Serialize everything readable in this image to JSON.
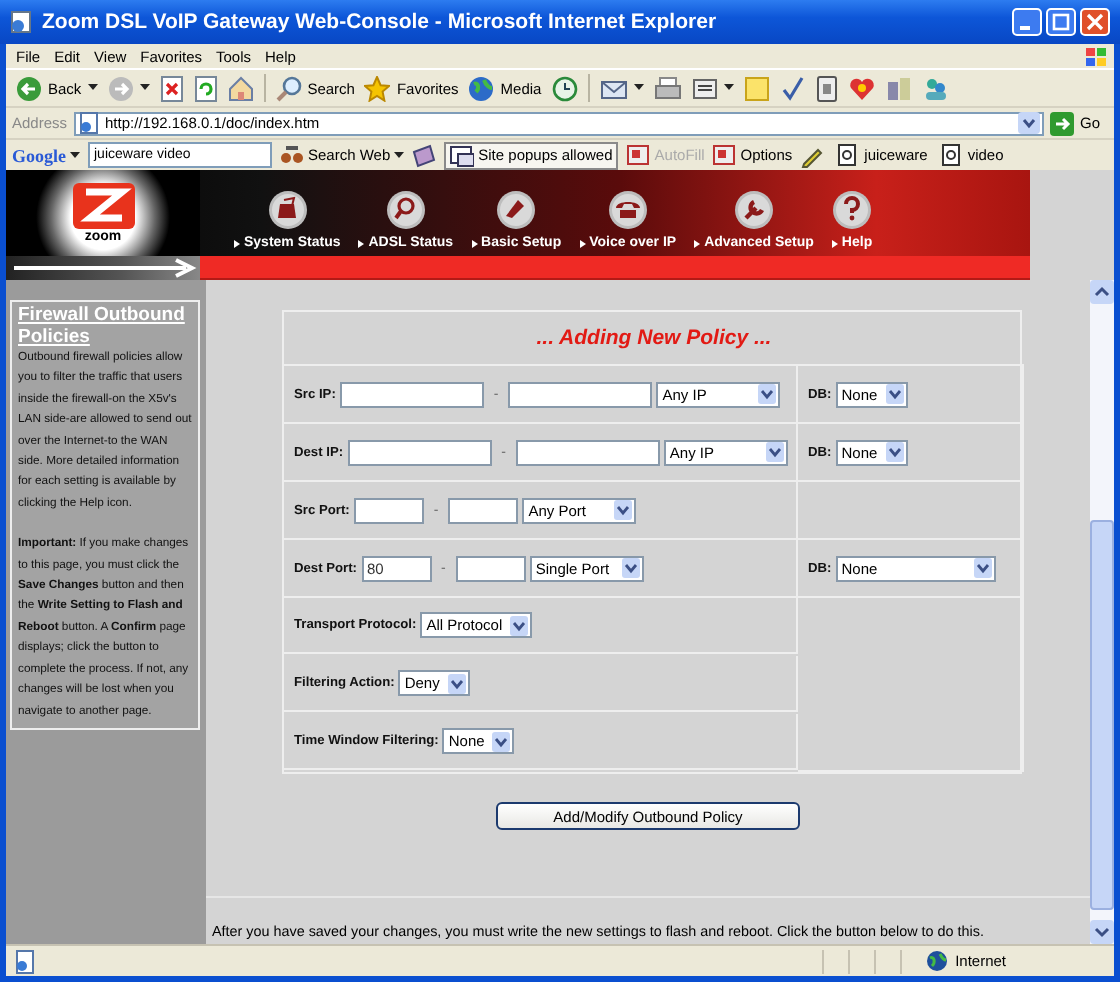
{
  "window": {
    "title": "Zoom DSL VoIP Gateway Web-Console - Microsoft Internet Explorer"
  },
  "menu": [
    "File",
    "Edit",
    "View",
    "Favorites",
    "Tools",
    "Help"
  ],
  "toolbar": {
    "back": "Back",
    "search": "Search",
    "favorites": "Favorites",
    "media": "Media"
  },
  "address": {
    "label": "Address",
    "value": "http://192.168.0.1/doc/index.htm",
    "go": "Go"
  },
  "google_bar": {
    "logo": "Google",
    "query": "juiceware video",
    "items": [
      {
        "label": "Search Web",
        "disabled": false,
        "kind": "menu"
      },
      {
        "label": "Site popups allowed",
        "disabled": false,
        "kind": "toggle"
      },
      {
        "label": "AutoFill",
        "disabled": true,
        "kind": "plain"
      },
      {
        "label": "Options",
        "disabled": false,
        "kind": "plain"
      },
      {
        "label": "juiceware",
        "disabled": false,
        "kind": "word"
      },
      {
        "label": "video",
        "disabled": false,
        "kind": "word"
      }
    ]
  },
  "brand": "zoom",
  "nav": [
    {
      "label": "System Status"
    },
    {
      "label": "ADSL Status"
    },
    {
      "label": "Basic Setup"
    },
    {
      "label": "Voice over IP"
    },
    {
      "label": "Advanced Setup"
    },
    {
      "label": "Help"
    }
  ],
  "sidebar": {
    "title": "Firewall Outbound Policies",
    "paragraphs": [
      "Outbound firewall policies allow you to filter the traffic that users inside the firewall-on the X5v's LAN side-are allowed to send out over the Internet-to the WAN side. More detailed information for each setting is available by clicking the Help icon.",
      "**Important:** If you make changes to this page, you must click the **Save Changes** button and then the **Write Setting to Flash and Reboot** button. A **Confirm** page displays; click the button to complete the process. If not, any changes will be lost when you navigate to another page."
    ]
  },
  "form": {
    "heading": "... Adding New Policy ...",
    "rows": [
      {
        "kind": "range",
        "label": "Src IP:",
        "separator": "-",
        "select": "Any IP",
        "db": {
          "label": "DB:",
          "value": "None"
        }
      },
      {
        "kind": "range",
        "label": "Dest IP:",
        "separator": "-",
        "select": "Any IP",
        "db": {
          "label": "DB:",
          "value": "None"
        }
      },
      {
        "kind": "port",
        "label": "Src Port:",
        "separator": "-",
        "select": "Any Port"
      },
      {
        "kind": "port",
        "label": "Dest Port:",
        "from": "80",
        "separator": "-",
        "select": "Single Port",
        "db": {
          "label": "DB:",
          "value": "None"
        }
      },
      {
        "kind": "select",
        "label": "Transport Protocol:",
        "select": "All Protocol"
      },
      {
        "kind": "select",
        "label": "Filtering Action:",
        "select": "Deny"
      },
      {
        "kind": "select",
        "label": "Time Window Filtering:",
        "select": "None"
      }
    ],
    "submit": "Add/Modify Outbound Policy"
  },
  "footer": "After you have saved your changes, you must write the new settings to flash and reboot. Click the button below to do this.",
  "status_bar": {
    "zone": "Internet"
  }
}
